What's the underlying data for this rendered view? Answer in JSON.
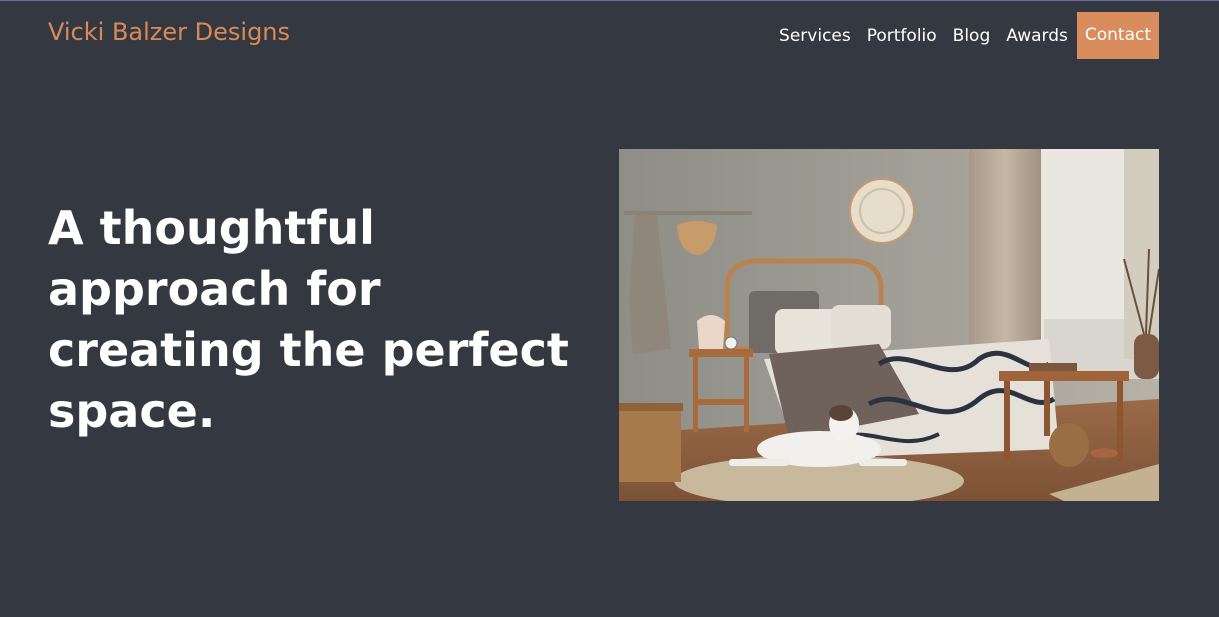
{
  "brand": {
    "name": "Vicki Balzer Designs"
  },
  "nav": {
    "items": [
      {
        "label": "Services"
      },
      {
        "label": "Portfolio"
      },
      {
        "label": "Blog"
      },
      {
        "label": "Awards"
      }
    ],
    "contact_label": "Contact"
  },
  "hero": {
    "headline": "A thoughtful approach for creating the perfect space."
  },
  "colors": {
    "background": "#343840",
    "accent": "#d98c5c",
    "text": "#ffffff"
  }
}
